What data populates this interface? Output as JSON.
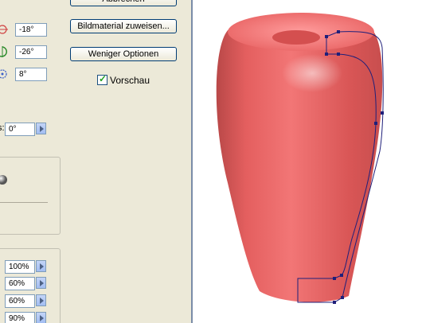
{
  "rotation": {
    "x_value": "-18°",
    "y_value": "-26°",
    "z_value": "8°"
  },
  "perspective": {
    "label_fragment": "s:",
    "value": "0°"
  },
  "buttons": {
    "cancel_label": "Abbrechen",
    "map_art_label": "Bildmaterial zuweisen...",
    "fewer_options_label": "Weniger Optionen"
  },
  "preview": {
    "label": "Vorschau",
    "checked": true
  },
  "lighting": {
    "values": [
      "100%",
      "60%",
      "60%",
      "90%"
    ]
  },
  "colors": {
    "panel_bg": "#ece9d8",
    "canvas_bg": "#ffffff",
    "object_red": "#e35e5e",
    "path_blue": "#1f1f7a"
  }
}
